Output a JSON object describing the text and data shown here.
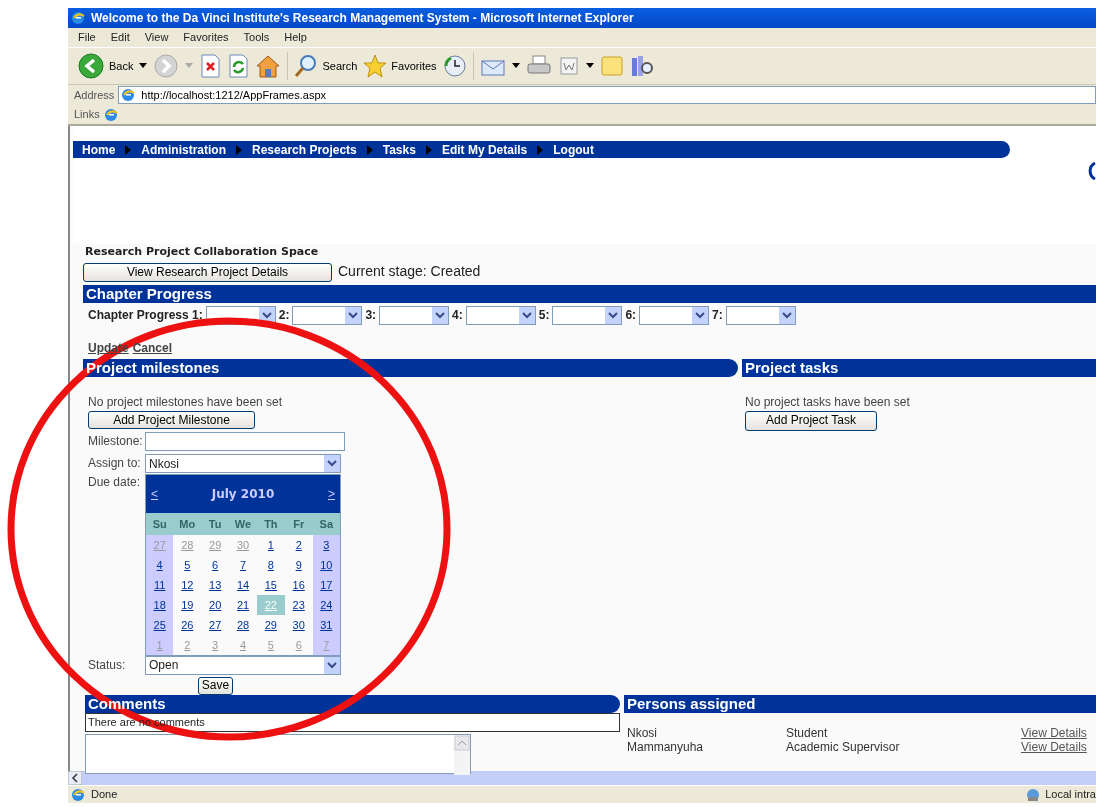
{
  "window": {
    "title": "Welcome to the Da Vinci Institute's Research Management System - Microsoft Internet Explorer"
  },
  "menu": [
    "File",
    "Edit",
    "View",
    "Favorites",
    "Tools",
    "Help"
  ],
  "toolbar": {
    "back": "Back",
    "search": "Search",
    "favorites": "Favorites"
  },
  "address": {
    "label": "Address",
    "url": "http://localhost:1212/AppFrames.aspx"
  },
  "links": {
    "label": "Links"
  },
  "nav": [
    "Home",
    "Administration",
    "Research Projects",
    "Tasks",
    "Edit My Details",
    "Logout"
  ],
  "heading": "Research Project Collaboration Space",
  "view_button": "View Research Project Details",
  "current_stage": "Current stage: Created",
  "chapter_progress": {
    "title": "Chapter Progress",
    "label": "Chapter Progress 1:",
    "selects": [
      "2:",
      "3:",
      "4:",
      "5:",
      "6:",
      "7:"
    ]
  },
  "update_link": "Update",
  "cancel_link": "Cancel",
  "milestones": {
    "title": "Project milestones",
    "empty_text": "No project milestones have been set",
    "add_button": "Add Project Milestone",
    "milestone_label": "Milestone:",
    "assign_label": "Assign to:",
    "assign_value": "Nkosi",
    "due_label": "Due date:",
    "calendar": {
      "prev": "<",
      "month": "July 2010",
      "next": ">",
      "weekdays": [
        "Su",
        "Mo",
        "Tu",
        "We",
        "Th",
        "Fr",
        "Sa"
      ],
      "weeks": [
        [
          {
            "day": "27",
            "other_month": true,
            "selected": false
          },
          {
            "day": "28",
            "other_month": true,
            "selected": false
          },
          {
            "day": "29",
            "other_month": true,
            "selected": false
          },
          {
            "day": "30",
            "other_month": true,
            "selected": false
          },
          {
            "day": "1",
            "other_month": false,
            "selected": false
          },
          {
            "day": "2",
            "other_month": false,
            "selected": false
          },
          {
            "day": "3",
            "other_month": false,
            "selected": false
          }
        ],
        [
          {
            "day": "4",
            "other_month": false,
            "selected": false
          },
          {
            "day": "5",
            "other_month": false,
            "selected": false
          },
          {
            "day": "6",
            "other_month": false,
            "selected": false
          },
          {
            "day": "7",
            "other_month": false,
            "selected": false
          },
          {
            "day": "8",
            "other_month": false,
            "selected": false
          },
          {
            "day": "9",
            "other_month": false,
            "selected": false
          },
          {
            "day": "10",
            "other_month": false,
            "selected": false
          }
        ],
        [
          {
            "day": "11",
            "other_month": false,
            "selected": false
          },
          {
            "day": "12",
            "other_month": false,
            "selected": false
          },
          {
            "day": "13",
            "other_month": false,
            "selected": false
          },
          {
            "day": "14",
            "other_month": false,
            "selected": false
          },
          {
            "day": "15",
            "other_month": false,
            "selected": false
          },
          {
            "day": "16",
            "other_month": false,
            "selected": false
          },
          {
            "day": "17",
            "other_month": false,
            "selected": false
          }
        ],
        [
          {
            "day": "18",
            "other_month": false,
            "selected": false
          },
          {
            "day": "19",
            "other_month": false,
            "selected": false
          },
          {
            "day": "20",
            "other_month": false,
            "selected": false
          },
          {
            "day": "21",
            "other_month": false,
            "selected": false
          },
          {
            "day": "22",
            "other_month": false,
            "selected": true
          },
          {
            "day": "23",
            "other_month": false,
            "selected": false
          },
          {
            "day": "24",
            "other_month": false,
            "selected": false
          }
        ],
        [
          {
            "day": "25",
            "other_month": false,
            "selected": false
          },
          {
            "day": "26",
            "other_month": false,
            "selected": false
          },
          {
            "day": "27",
            "other_month": false,
            "selected": false
          },
          {
            "day": "28",
            "other_month": false,
            "selected": false
          },
          {
            "day": "29",
            "other_month": false,
            "selected": false
          },
          {
            "day": "30",
            "other_month": false,
            "selected": false
          },
          {
            "day": "31",
            "other_month": false,
            "selected": false
          }
        ],
        [
          {
            "day": "1",
            "other_month": true,
            "selected": false
          },
          {
            "day": "2",
            "other_month": true,
            "selected": false
          },
          {
            "day": "3",
            "other_month": true,
            "selected": false
          },
          {
            "day": "4",
            "other_month": true,
            "selected": false
          },
          {
            "day": "5",
            "other_month": true,
            "selected": false
          },
          {
            "day": "6",
            "other_month": true,
            "selected": false
          },
          {
            "day": "7",
            "other_month": true,
            "selected": false
          }
        ]
      ]
    },
    "status_label": "Status:",
    "status_value": "Open",
    "save_button": "Save"
  },
  "tasks": {
    "title": "Project tasks",
    "empty_text": "No project tasks have been set",
    "add_button": "Add Project Task"
  },
  "comments": {
    "title": "Comments",
    "empty_text": "There are no comments"
  },
  "persons": {
    "title": "Persons assigned",
    "rows": [
      {
        "name": "Nkosi",
        "role": "Student",
        "link": "View Details"
      },
      {
        "name": "Mammanyuha",
        "role": "Academic Supervisor",
        "link": "View Details"
      }
    ]
  },
  "status_bar": {
    "text": "Done",
    "zone": "Local intra"
  }
}
